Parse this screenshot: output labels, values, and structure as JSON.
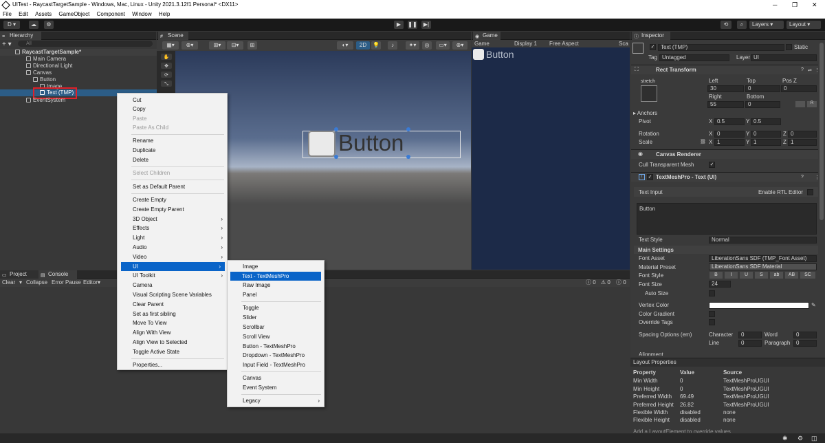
{
  "window": {
    "title": "UITest - RaycastTargetSample - Windows, Mac, Linux - Unity 2021.3.12f1 Personal* <DX11>",
    "minimize": "─",
    "maximize": "❐",
    "close": "✕"
  },
  "menu": [
    "File",
    "Edit",
    "Assets",
    "GameObject",
    "Component",
    "Window",
    "Help"
  ],
  "toolbar": {
    "account": "D",
    "layers": "Layers",
    "layout": "Layout"
  },
  "hierarchy": {
    "tab": "Hierarchy",
    "search_placeholder": "All",
    "items": [
      "RaycastTargetSample*",
      "Main Camera",
      "Directional Light",
      "Canvas",
      "Button",
      "Image",
      "Text (TMP)",
      "EventSystem"
    ]
  },
  "scene": {
    "tab": "Scene",
    "mode_2d": "2D",
    "button_text": "Button"
  },
  "game": {
    "tab": "Game",
    "view": "Game",
    "display": "Display 1",
    "aspect": "Free Aspect",
    "scale": "Sca",
    "button_text": "Button"
  },
  "bottom": {
    "project_tab": "Project",
    "console_tab": "Console",
    "clear": "Clear",
    "collapse": "Collapse",
    "error_pause": "Error Pause",
    "editor": "Editor",
    "count_info": "0",
    "count_warn": "0",
    "count_err": "0"
  },
  "context_menu": {
    "items": [
      {
        "label": "Cut",
        "enabled": true
      },
      {
        "label": "Copy",
        "enabled": true
      },
      {
        "label": "Paste",
        "enabled": false
      },
      {
        "label": "Paste As Child",
        "enabled": false
      },
      {
        "label": "Rename",
        "enabled": true
      },
      {
        "label": "Duplicate",
        "enabled": true
      },
      {
        "label": "Delete",
        "enabled": true
      },
      {
        "label": "Select Children",
        "enabled": false
      },
      {
        "label": "Set as Default Parent",
        "enabled": true
      },
      {
        "label": "Create Empty",
        "enabled": true
      },
      {
        "label": "Create Empty Parent",
        "enabled": true
      },
      {
        "label": "3D Object",
        "enabled": true
      },
      {
        "label": "Effects",
        "enabled": true
      },
      {
        "label": "Light",
        "enabled": true
      },
      {
        "label": "Audio",
        "enabled": true
      },
      {
        "label": "Video",
        "enabled": true
      },
      {
        "label": "UI",
        "enabled": true
      },
      {
        "label": "UI Toolkit",
        "enabled": true
      },
      {
        "label": "Camera",
        "enabled": true
      },
      {
        "label": "Visual Scripting Scene Variables",
        "enabled": true
      },
      {
        "label": "Clear Parent",
        "enabled": true
      },
      {
        "label": "Set as first sibling",
        "enabled": true
      },
      {
        "label": "Move To View",
        "enabled": true
      },
      {
        "label": "Align With View",
        "enabled": true
      },
      {
        "label": "Align View to Selected",
        "enabled": true
      },
      {
        "label": "Toggle Active State",
        "enabled": true
      },
      {
        "label": "Properties...",
        "enabled": true
      }
    ],
    "submenu": [
      "Image",
      "Text - TextMeshPro",
      "Raw Image",
      "Panel",
      "Toggle",
      "Slider",
      "Scrollbar",
      "Scroll View",
      "Button - TextMeshPro",
      "Dropdown - TextMeshPro",
      "Input Field - TextMeshPro",
      "Canvas",
      "Event System",
      "Legacy"
    ]
  },
  "inspector": {
    "tab": "Inspector",
    "object_name": "Text (TMP)",
    "static": "Static",
    "tag_label": "Tag",
    "tag": "Untagged",
    "layer_label": "Layer",
    "layer": "UI",
    "rect_transform": {
      "title": "Rect Transform",
      "stretch": "stretch",
      "left_label": "Left",
      "top_label": "Top",
      "posz_label": "Pos Z",
      "left": "30",
      "top": "0",
      "posz": "0",
      "right_label": "Right",
      "bottom_label": "Bottom",
      "right": "55",
      "bottom": "0",
      "anchors": "Anchors",
      "pivot": "Pivot",
      "pivot_x": "0.5",
      "pivot_y": "0.5",
      "rotation": "Rotation",
      "rot_x": "0",
      "rot_y": "0",
      "rot_z": "0",
      "scale": "Scale",
      "scale_x": "1",
      "scale_y": "1",
      "scale_z": "1",
      "raw_btn": "R"
    },
    "canvas_renderer": {
      "title": "Canvas Renderer",
      "cull": "Cull Transparent Mesh"
    },
    "tmp": {
      "title": "TextMeshPro - Text (UI)",
      "text_input": "Text Input",
      "rtl": "Enable RTL Editor",
      "text": "Button",
      "text_style_label": "Text Style",
      "text_style": "Normal",
      "main_settings": "Main Settings",
      "font_asset_label": "Font Asset",
      "font_asset": "LiberationSans SDF (TMP_Font Asset)",
      "material_preset_label": "Material Preset",
      "material_preset": "LiberationSans SDF Material",
      "font_style_label": "Font Style",
      "font_styles": [
        "B",
        "I",
        "U",
        "S",
        "ab",
        "AB",
        "SC"
      ],
      "font_size_label": "Font Size",
      "font_size": "24",
      "auto_size": "Auto Size",
      "vertex_color": "Vertex Color",
      "color_gradient": "Color Gradient",
      "override_tags": "Override Tags",
      "spacing": "Spacing Options (em)",
      "character": "Character",
      "character_val": "0",
      "word": "Word",
      "word_val": "0",
      "line": "Line",
      "line_val": "0",
      "paragraph": "Paragraph",
      "paragraph_val": "0",
      "alignment": "Alignment"
    }
  },
  "layout_properties": {
    "title": "Layout Properties",
    "headers": [
      "Property",
      "Value",
      "Source"
    ],
    "rows": [
      [
        "Min Width",
        "0",
        "TextMeshProUGUI"
      ],
      [
        "Min Height",
        "0",
        "TextMeshProUGUI"
      ],
      [
        "Preferred Width",
        "69.49",
        "TextMeshProUGUI"
      ],
      [
        "Preferred Height",
        "26.82",
        "TextMeshProUGUI"
      ],
      [
        "Flexible Width",
        "disabled",
        "none"
      ],
      [
        "Flexible Height",
        "disabled",
        "none"
      ]
    ],
    "footer": "Add a LayoutElement to override values"
  },
  "colors": {
    "highlight": "#2c5d87",
    "menu_highlight": "#0a64c8",
    "red_box": "#e0202a",
    "scene_sky": "#2a3d60",
    "ground": "#4b4b4b"
  }
}
